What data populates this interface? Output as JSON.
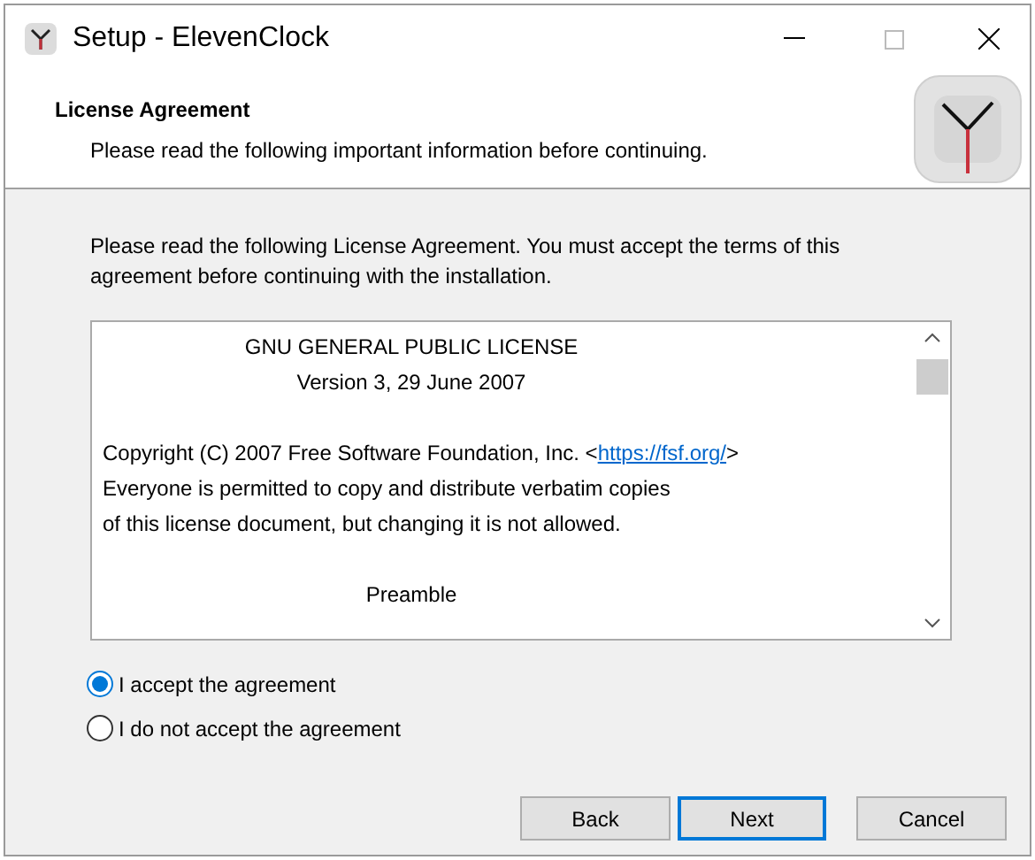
{
  "window": {
    "title": "Setup - ElevenClock"
  },
  "header": {
    "title": "License Agreement",
    "subtitle": "Please read the following important information before continuing."
  },
  "intro": "Please read the following License Agreement. You must accept the terms of this agreement before continuing with the installation.",
  "license_lines": [
    {
      "kind": "center",
      "text": "GNU GENERAL PUBLIC LICENSE"
    },
    {
      "kind": "center",
      "text": "Version 3, 29 June 2007"
    },
    {
      "kind": "blank"
    },
    {
      "kind": "link",
      "text": "Copyright (C) 2007 Free Software Foundation, Inc. <",
      "link": "https://fsf.org/",
      "suffix": ">"
    },
    {
      "kind": "left",
      "text": "Everyone is permitted to copy and distribute verbatim copies"
    },
    {
      "kind": "left",
      "text": "of this license document, but changing it is not allowed."
    },
    {
      "kind": "blank"
    },
    {
      "kind": "center",
      "text": "Preamble"
    }
  ],
  "options": [
    {
      "label": "I accept the agreement",
      "selected": true
    },
    {
      "label": "I do not accept the agreement",
      "selected": false
    }
  ],
  "buttons": [
    {
      "label": "Back",
      "default": false
    },
    {
      "label": "Next",
      "default": true
    },
    {
      "label": "Cancel",
      "default": false
    }
  ]
}
